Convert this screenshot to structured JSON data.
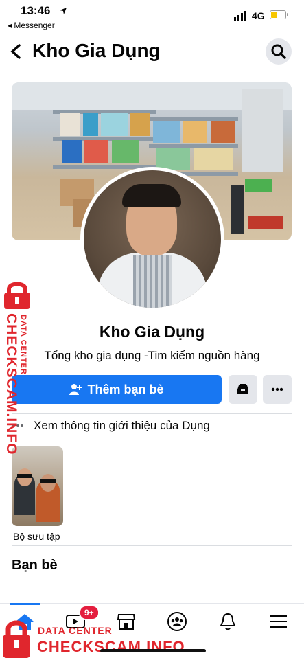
{
  "status_bar": {
    "time": "13:46",
    "back_app": "Messenger",
    "network": "4G"
  },
  "header": {
    "title": "Kho Gia Dụng",
    "back_icon": "chevron-left-icon",
    "search_icon": "search-icon"
  },
  "profile": {
    "name": "Kho Gia Dụng",
    "bio": "Tổng kho gia dụng -Tim kiếm nguồn hàng"
  },
  "actions": {
    "add_friend_label": "Thêm bạn bè",
    "add_friend_icon": "add-person-icon",
    "message_icon": "inbox-icon",
    "more_icon": "more-icon"
  },
  "intro": {
    "label": "Xem thông tin giới thiệu của Dụng"
  },
  "collection": {
    "label": "Bộ sưu tập"
  },
  "friends": {
    "heading": "Bạn bè"
  },
  "bottom_nav": {
    "badge": "9+",
    "items": [
      "home-icon",
      "video-icon",
      "marketplace-icon",
      "groups-icon",
      "notifications-icon",
      "menu-icon"
    ]
  },
  "watermark": {
    "line1": "DATA CENTER",
    "line2": "CHECKSCAM.INFO"
  },
  "colors": {
    "primary": "#1877f2",
    "watermark_red": "#e0262d",
    "badge_red": "#e41e3f"
  }
}
